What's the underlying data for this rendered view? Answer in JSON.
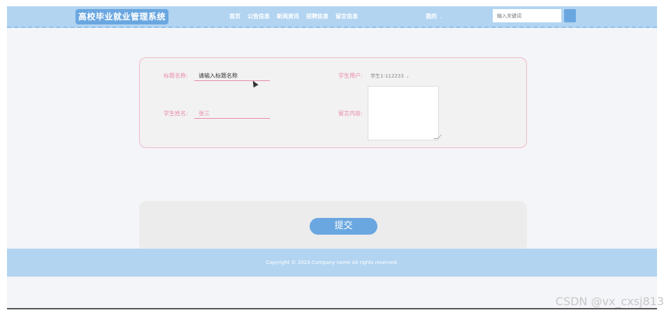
{
  "header": {
    "logo": "高校毕业就业管理系统",
    "nav": [
      "首页",
      "公告信息",
      "新闻资讯",
      "招聘信息",
      "留言信息"
    ],
    "my_menu": "我的",
    "search_placeholder": "输入关键词"
  },
  "form": {
    "title_label": "标题名称:",
    "title_value": "请输入标题名称",
    "student_user_label": "学生用户:",
    "student_user_value": "学生1-112233",
    "student_name_label": "学生姓名:",
    "student_name_value": "张三",
    "message_label": "留言内容:"
  },
  "submit_label": "提交",
  "footer": {
    "copyright": "Copyright © 2023.Company name All rights reserved."
  },
  "watermark": "CSDN @vx_cxsj813"
}
